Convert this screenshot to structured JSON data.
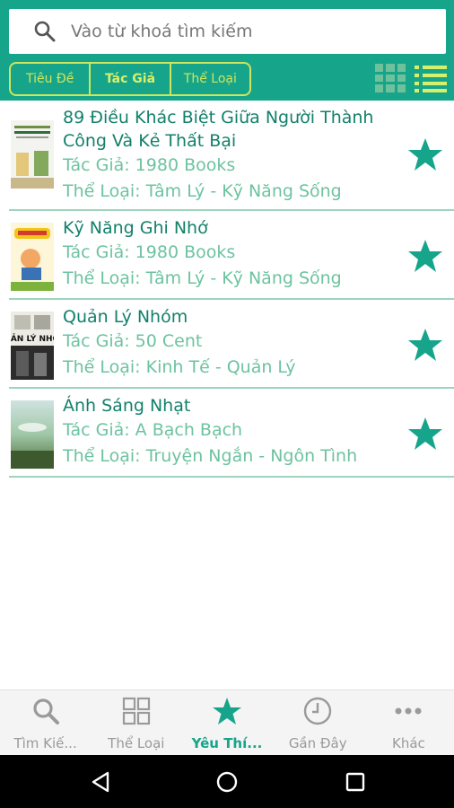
{
  "search": {
    "placeholder": "Vào từ khoá tìm kiếm",
    "icon": "search-icon"
  },
  "filters": [
    {
      "label": "Tiêu Đề",
      "active": false
    },
    {
      "label": "Tác Giả",
      "active": true
    },
    {
      "label": "Thể Loại",
      "active": false
    }
  ],
  "view_modes": [
    "grid-view-icon",
    "list-view-icon"
  ],
  "books": [
    {
      "title": "89 Điều Khác Biệt Giữa Người Thành Công Và Kẻ Thất Bại",
      "author": "Tác Giả: 1980 Books",
      "genre": "Thể Loại: Tâm Lý - Kỹ Năng Sống",
      "favorite": true
    },
    {
      "title": "Kỹ Năng Ghi Nhớ",
      "author": "Tác Giả: 1980 Books",
      "genre": "Thể Loại: Tâm Lý - Kỹ Năng Sống",
      "favorite": true
    },
    {
      "title": "Quản Lý Nhóm",
      "author": "Tác Giả: 50 Cent",
      "genre": "Thể Loại: Kinh Tế - Quản Lý",
      "favorite": true,
      "cover_text": "QUẢN LÝ NHÓM"
    },
    {
      "title": "Ánh Sáng Nhạt",
      "author": "Tác Giả: A Bạch Bạch",
      "genre": "Thể Loại: Truyện Ngắn - Ngôn Tình",
      "favorite": true
    }
  ],
  "tabs": [
    {
      "label": "Tìm Kiế...",
      "icon": "search-icon",
      "active": false
    },
    {
      "label": "Thể Loại",
      "icon": "grid-icon",
      "active": false
    },
    {
      "label": "Yêu Thí...",
      "icon": "star-icon",
      "active": true
    },
    {
      "label": "Gần Đây",
      "icon": "clock-icon",
      "active": false
    },
    {
      "label": "Khác",
      "icon": "more-icon",
      "active": false
    }
  ],
  "colors": {
    "primary": "#16a58a",
    "accent": "#d8ef6b",
    "title": "#12806b",
    "meta": "#6dc3a0",
    "inactive": "#9a9a9a"
  }
}
